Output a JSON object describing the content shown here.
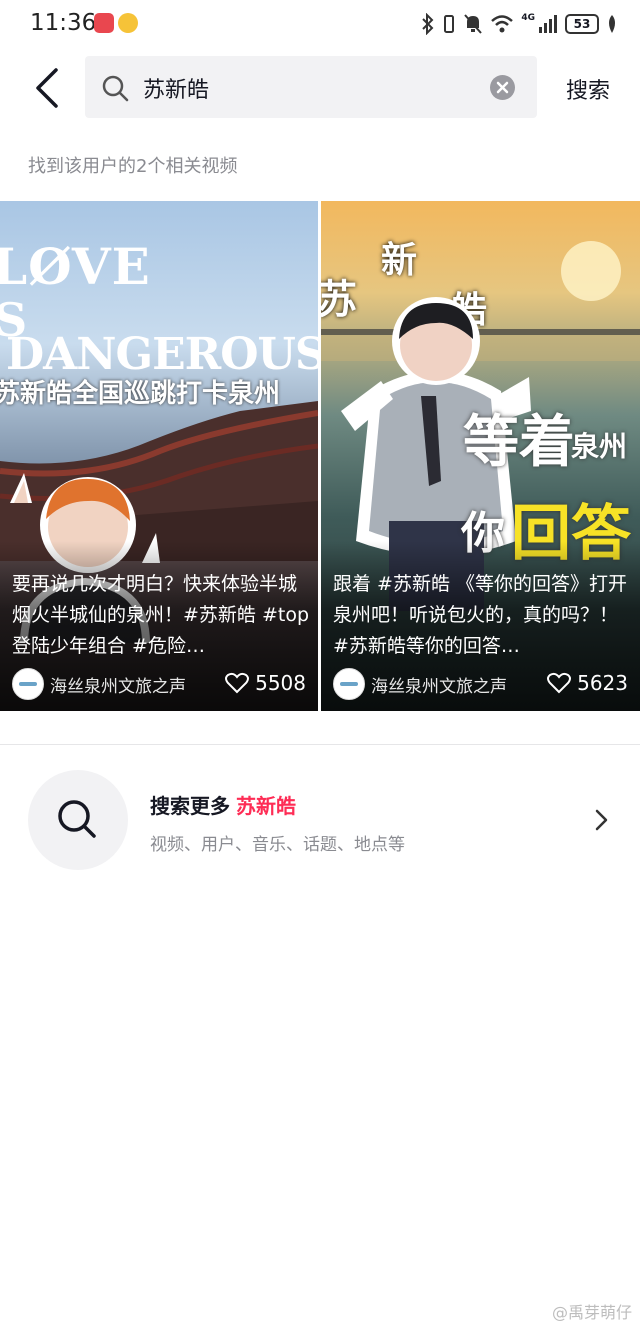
{
  "status_bar": {
    "time": "11:36",
    "battery": "53",
    "network": "4G"
  },
  "search": {
    "query": "苏新皓",
    "submit_label": "搜索"
  },
  "result_count": "找到该用户的2个相关视频",
  "videos": [
    {
      "poster_lines": [
        "LØVE",
        "S",
        "DANGEROUS"
      ],
      "poster_subtitle": "苏新皓全国巡跳打卡泉州",
      "title": "要再说几次才明白？快来体验半城烟火半城仙的泉州！#苏新皓 #top登陆少年组合 #危险…",
      "author": "海丝泉州文旅之声",
      "likes": "5508"
    },
    {
      "poster_chars": [
        "苏",
        "新",
        "皓"
      ],
      "poster_big": [
        "等着",
        "泉州",
        "你",
        "回答"
      ],
      "title": "跟着 #苏新皓 《等你的回答》打开泉州吧！听说包火的，真的吗？！ #苏新皓等你的回答…",
      "author": "海丝泉州文旅之声",
      "likes": "5623"
    }
  ],
  "search_more": {
    "label": "搜索更多",
    "keyword": "苏新皓",
    "subtitle": "视频、用户、音乐、话题、地点等"
  },
  "watermark": "@禹芽萌仔",
  "colors": {
    "accent": "#fe2c55",
    "search_bg": "#f2f2f4",
    "muted_text": "#8a8b91"
  }
}
